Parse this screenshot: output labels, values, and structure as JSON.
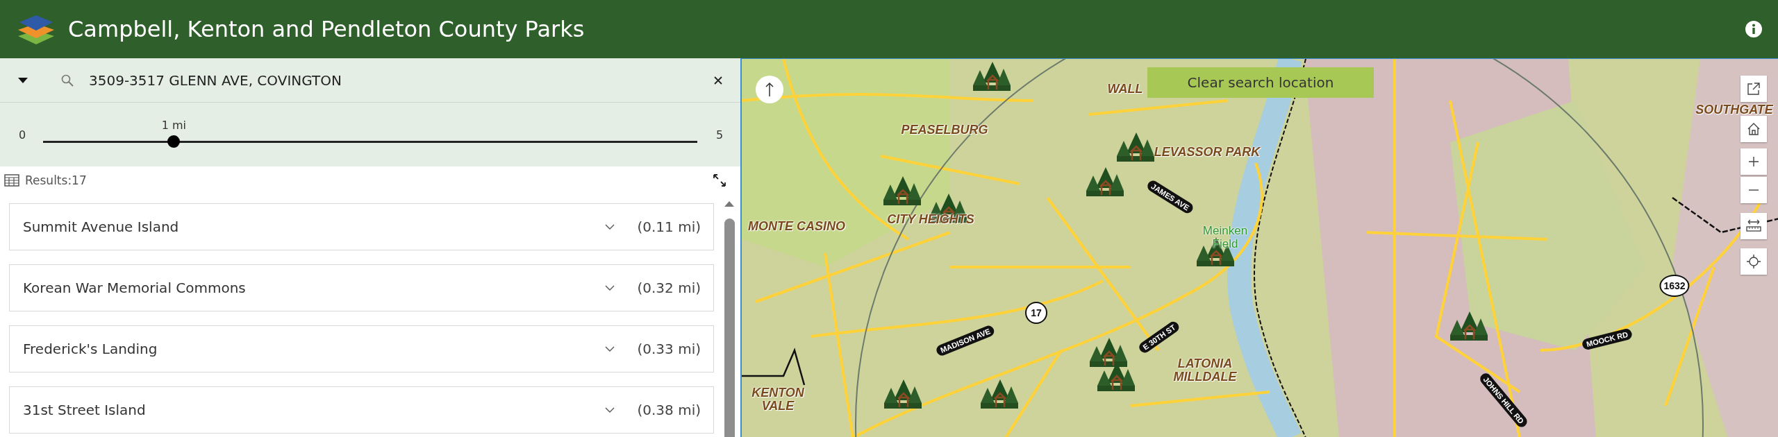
{
  "header": {
    "title": "Campbell, Kenton and Pendleton County Parks"
  },
  "search": {
    "value": "3509-3517 GLENN AVE, COVINGTON"
  },
  "distance_slider": {
    "min_label": "0",
    "max_label": "5",
    "value_label": "1 mi",
    "level": 0.2
  },
  "results": {
    "label": "Results:17",
    "items": [
      {
        "name": "Summit Avenue Island",
        "distance": "(0.11 mi)",
        "expanded": false
      },
      {
        "name": "Korean War Memorial Commons",
        "distance": "(0.32 mi)",
        "expanded": false
      },
      {
        "name": "Frederick's Landing",
        "distance": "(0.33 mi)",
        "expanded": false
      },
      {
        "name": "31st Street Island",
        "distance": "(0.38 mi)",
        "expanded": false
      }
    ]
  },
  "map": {
    "clear_button": "Clear search location",
    "labels": [
      {
        "text": "WALL",
        "kind": "place"
      },
      {
        "text": "PEASELBURG",
        "kind": "place"
      },
      {
        "text": "LEVASSOR PARK",
        "kind": "place"
      },
      {
        "text": "JAMES AVE",
        "kind": "road"
      },
      {
        "text": "MONTE CASINO",
        "kind": "place"
      },
      {
        "text": "CITY HEIGHTS",
        "kind": "place"
      },
      {
        "text": "Meinken Field",
        "kind": "park"
      },
      {
        "text": "17",
        "kind": "shield"
      },
      {
        "text": "MADISON AVE",
        "kind": "road"
      },
      {
        "text": "E 30TH ST",
        "kind": "road"
      },
      {
        "text": "LATONIA MILLDALE",
        "kind": "place"
      },
      {
        "text": "KENTON VALE",
        "kind": "place"
      },
      {
        "text": "SOUTHGATE",
        "kind": "place"
      },
      {
        "text": "1632",
        "kind": "shield"
      },
      {
        "text": "MOOCK RD",
        "kind": "road"
      },
      {
        "text": "JOHNS HILL RD",
        "kind": "road"
      }
    ]
  }
}
